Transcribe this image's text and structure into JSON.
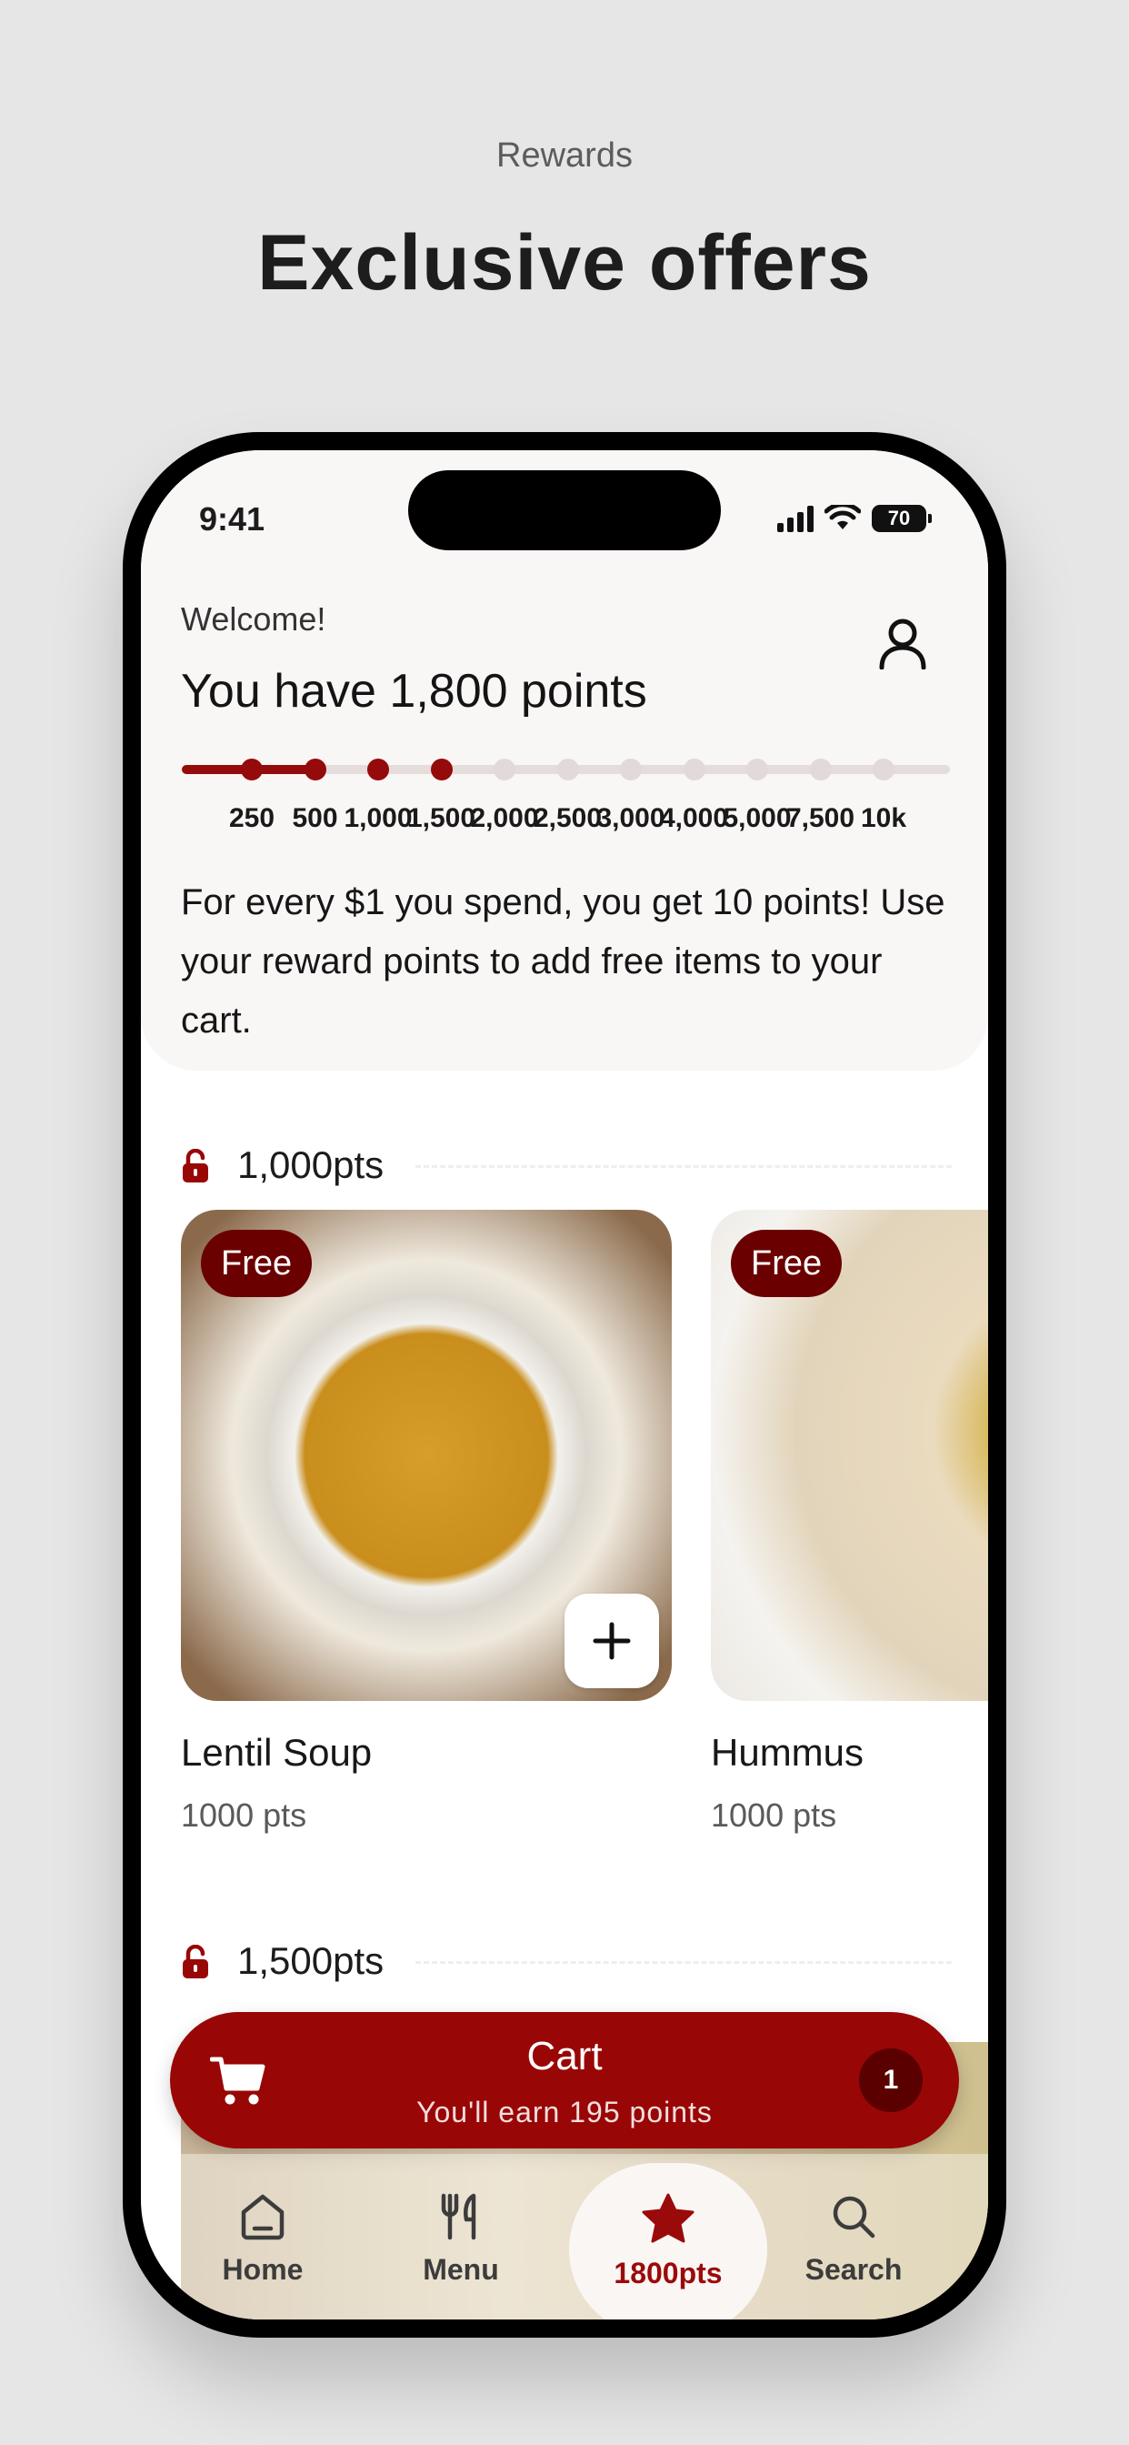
{
  "header": {
    "subtitle": "Rewards",
    "title": "Exclusive offers"
  },
  "status_bar": {
    "time": "9:41",
    "battery": "70"
  },
  "rewards": {
    "welcome": "Welcome!",
    "points_title": "You have 1,800 points",
    "current_points": 1800,
    "milestones": [
      "250",
      "500",
      "1,000",
      "1,500",
      "2,000",
      "2,500",
      "3,000",
      "4,000",
      "5,000",
      "7,500",
      "10k"
    ],
    "unlocked_count": 4,
    "info": "For every $1 you spend, you get 10 points! Use your reward points to add free items to your cart."
  },
  "tiers": [
    {
      "label": "1,000pts"
    },
    {
      "label": "1,500pts"
    }
  ],
  "items": [
    {
      "name": "Lentil Soup",
      "points": "1000 pts",
      "badge": "Free",
      "icon": "plus-icon"
    },
    {
      "name": "Hummus",
      "points": "1000 pts",
      "badge": "Free"
    }
  ],
  "cart": {
    "title": "Cart",
    "subtitle": "You'll earn 195 points",
    "count": "1"
  },
  "tabs": [
    {
      "label": "Home",
      "icon": "home-icon"
    },
    {
      "label": "Menu",
      "icon": "utensils-icon"
    },
    {
      "label": "1800pts",
      "icon": "star-icon"
    },
    {
      "label": "Search",
      "icon": "search-icon"
    }
  ],
  "colors": {
    "accent": "#990606",
    "badge": "#6b0000",
    "background": "#e6e6e6"
  }
}
